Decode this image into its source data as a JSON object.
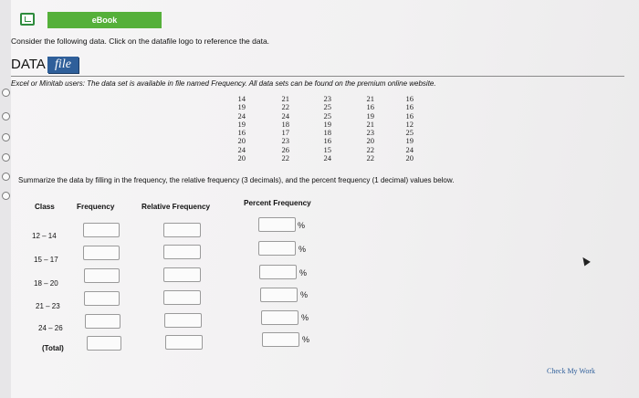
{
  "header": {
    "ebook_label": "eBook"
  },
  "instructions": "Consider the following data. Click on the datafile logo to reference the data.",
  "datafile": {
    "label": "DATA",
    "logo_text": "file"
  },
  "note": "Excel or Minitab users: The data set is available in file named Frequency. All data sets can be found on the premium online website.",
  "data_columns": [
    [
      "14",
      "19",
      "24",
      "19",
      "16",
      "20",
      "24",
      "20"
    ],
    [
      "21",
      "22",
      "24",
      "18",
      "17",
      "23",
      "26",
      "22"
    ],
    [
      "23",
      "25",
      "25",
      "19",
      "18",
      "16",
      "15",
      "24"
    ],
    [
      "21",
      "16",
      "19",
      "21",
      "23",
      "20",
      "22",
      "22"
    ],
    [
      "16",
      "16",
      "16",
      "12",
      "25",
      "19",
      "24",
      "20"
    ]
  ],
  "prompt": "Summarize the data by filling in the frequency, the relative frequency (3 decimals), and the percent frequency (1 decimal) values below.",
  "table": {
    "headers": [
      "Class",
      "Frequency",
      "Relative Frequency",
      "Percent Frequency"
    ],
    "rows": [
      {
        "class": "12 – 14",
        "frequency": "",
        "relative": "",
        "percent": ""
      },
      {
        "class": "15 – 17",
        "frequency": "",
        "relative": "",
        "percent": ""
      },
      {
        "class": "18 – 20",
        "frequency": "",
        "relative": "",
        "percent": ""
      },
      {
        "class": "21 – 23",
        "frequency": "",
        "relative": "",
        "percent": ""
      },
      {
        "class": "24 – 26",
        "frequency": "",
        "relative": "",
        "percent": ""
      },
      {
        "class": "(Total)",
        "frequency": "",
        "relative": "",
        "percent": ""
      }
    ],
    "percent_sign": "%"
  },
  "check_button": "Check My Work",
  "colors": {
    "ebook_green": "#55b03a",
    "file_blue": "#2f5f9a"
  }
}
